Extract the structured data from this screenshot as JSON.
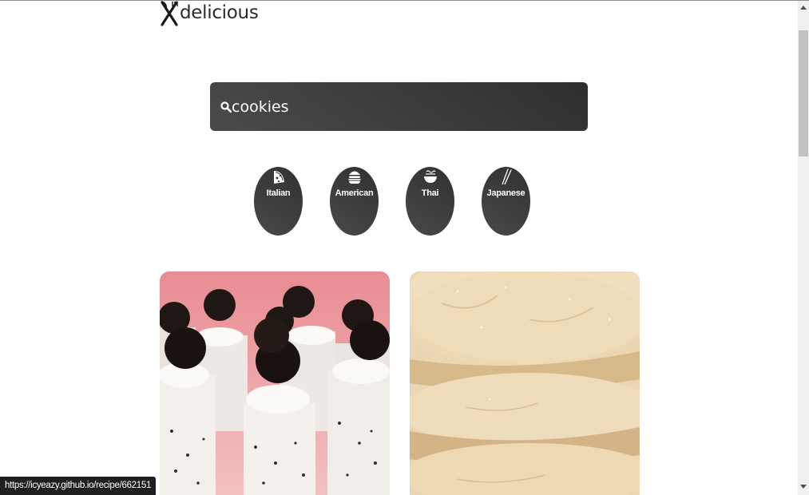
{
  "header": {
    "logo_text": "delicious",
    "logo_icon": "fork-knife-icon"
  },
  "search": {
    "value": "cookies",
    "icon": "search-icon"
  },
  "categories": [
    {
      "label": "Italian",
      "icon": "pizza-icon"
    },
    {
      "label": "American",
      "icon": "hamburger-icon"
    },
    {
      "label": "Thai",
      "icon": "noodle-bowl-icon"
    },
    {
      "label": "Japanese",
      "icon": "chopsticks-icon"
    }
  ],
  "recipes": [
    {
      "image": "oreo-cheesecake-bites-photo"
    },
    {
      "image": "sugar-cookies-stack-photo"
    }
  ],
  "status_bar": {
    "url": "https://icyeazy.github.io/recipe/662151"
  },
  "colors": {
    "dark_surface": "#3a3a3a",
    "text_light": "#ffffff",
    "text_dark": "#2b2b2b"
  }
}
